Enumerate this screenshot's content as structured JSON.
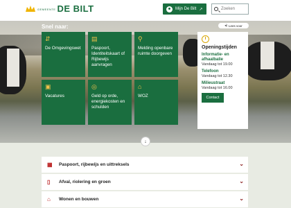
{
  "header": {
    "logo_small": "GEMEENTE",
    "logo_big": "DE BILT",
    "mijn_label": "Mijn De Bilt",
    "search_placeholder": "Zoeken"
  },
  "hero": {
    "snel_naar": "Snel naar:",
    "lees_voor": "Lees voor",
    "tiles": [
      {
        "label": "De Omgevingswet",
        "icon": "signpost-icon"
      },
      {
        "label": "Paspoort, Identiteitskaart of Rijbewijs aanvragen",
        "icon": "id-card-icon"
      },
      {
        "label": "Melding openbare ruimte doorgeven",
        "icon": "person-pin-icon"
      },
      {
        "label": "Vacatures",
        "icon": "briefcase-icon"
      },
      {
        "label": "Geld op orde, energiekosten en schulden",
        "icon": "coins-icon"
      },
      {
        "label": "WOZ",
        "icon": "house-euro-icon"
      }
    ],
    "opening": {
      "title": "Openingstijden",
      "items": [
        {
          "head": "Informatie- en afhaalbalie",
          "time": "Vandaag tot 19.00"
        },
        {
          "head": "Telefoon",
          "time": "Vandaag tot 12.30"
        },
        {
          "head": "Milieustraat",
          "time": "Vandaag tot 16.00"
        }
      ],
      "contact": "Contact"
    }
  },
  "accordion": [
    {
      "label": "Paspoort, rijbewijs en uittreksels",
      "icon": "passport-icon"
    },
    {
      "label": "Afval, riolering en groen",
      "icon": "waste-bin-icon"
    },
    {
      "label": "Wonen en bouwen",
      "icon": "house-icon"
    }
  ],
  "colors": {
    "brand_green": "#1a6e3f",
    "accent_yellow": "#f0c14b",
    "chevron_red": "#8a1c1c"
  }
}
